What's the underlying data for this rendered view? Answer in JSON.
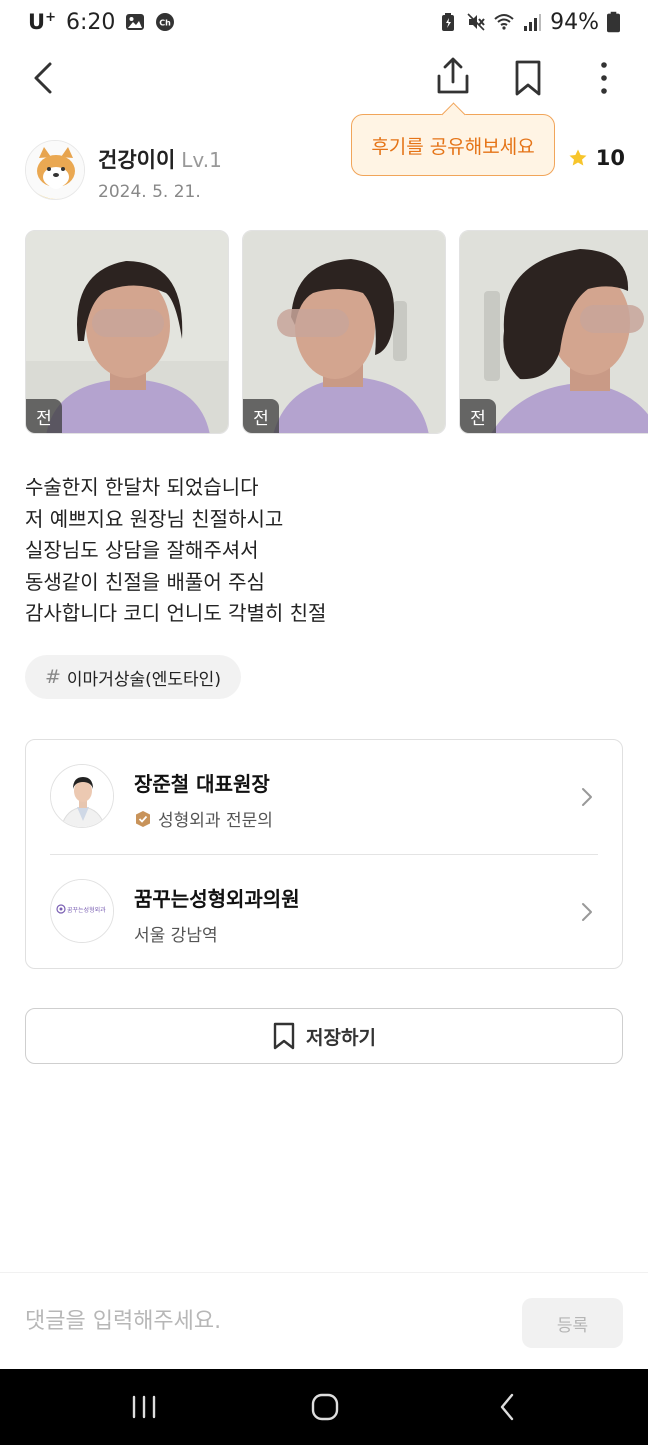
{
  "status_bar": {
    "carrier": "U",
    "carrier_sup": "+",
    "time": "6:20",
    "battery": "94%"
  },
  "toolbar": {
    "share_tooltip": "후기를 공유해보세요"
  },
  "author": {
    "name": "건강이이",
    "level": "Lv.1",
    "date": "2024. 5. 21.",
    "rating": "10"
  },
  "photos": [
    {
      "tag": "전"
    },
    {
      "tag": "전"
    },
    {
      "tag": "전"
    }
  ],
  "review": {
    "lines": [
      "수술한지 한달차 되었습니다",
      "저 예쁘지요 원장님 친절하시고",
      "실장님도 상담을 잘해주셔서",
      "동생같이 친절을 배풀어 주심",
      "감사합니다 코디 언니도 각별히 친절"
    ]
  },
  "hashtag": {
    "symbol": "#",
    "label": "이마거상술(엔도타인)"
  },
  "doctor": {
    "name": "장준철 대표원장",
    "specialty": "성형외과 전문의"
  },
  "clinic": {
    "name": "꿈꾸는성형외과의원",
    "location": "서울 강남역",
    "logo_text": "꿈꾸는성형외과"
  },
  "save_button": {
    "label": "저장하기"
  },
  "comment": {
    "placeholder": "댓글을 입력해주세요.",
    "submit_label": "등록"
  },
  "colors": {
    "accent_orange": "#e57417",
    "tooltip_bg": "#fff4e4",
    "star": "#f7c52b",
    "badge": "#c8935a"
  }
}
